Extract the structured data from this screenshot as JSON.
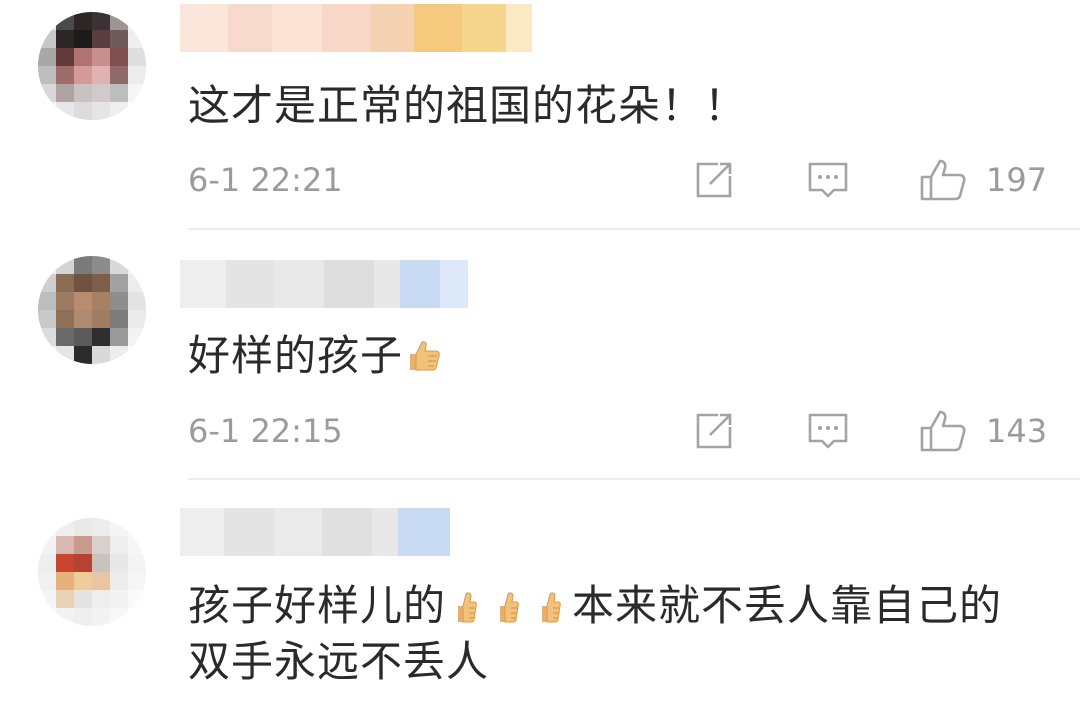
{
  "comments": [
    {
      "text": "这才是正常的祖国的花朵！！",
      "timestamp": "6-1 22:21",
      "likes": "197"
    },
    {
      "text": "好样的孩子",
      "timestamp": "6-1 22:15",
      "likes": "143"
    },
    {
      "text_line1": "孩子好样儿的",
      "text_line1_tail": "本来就不丢人靠自己的",
      "text_line2": "双手永远不丢人"
    }
  ],
  "icons": {
    "share": "share-icon",
    "reply": "comment-icon",
    "like": "thumbs-up-icon",
    "emoji": "thumbs-up-emoji"
  },
  "colors": {
    "text": "#2a2a2a",
    "meta": "#9b9b9b",
    "divider": "#ececec",
    "emoji": "#f2c27a"
  }
}
